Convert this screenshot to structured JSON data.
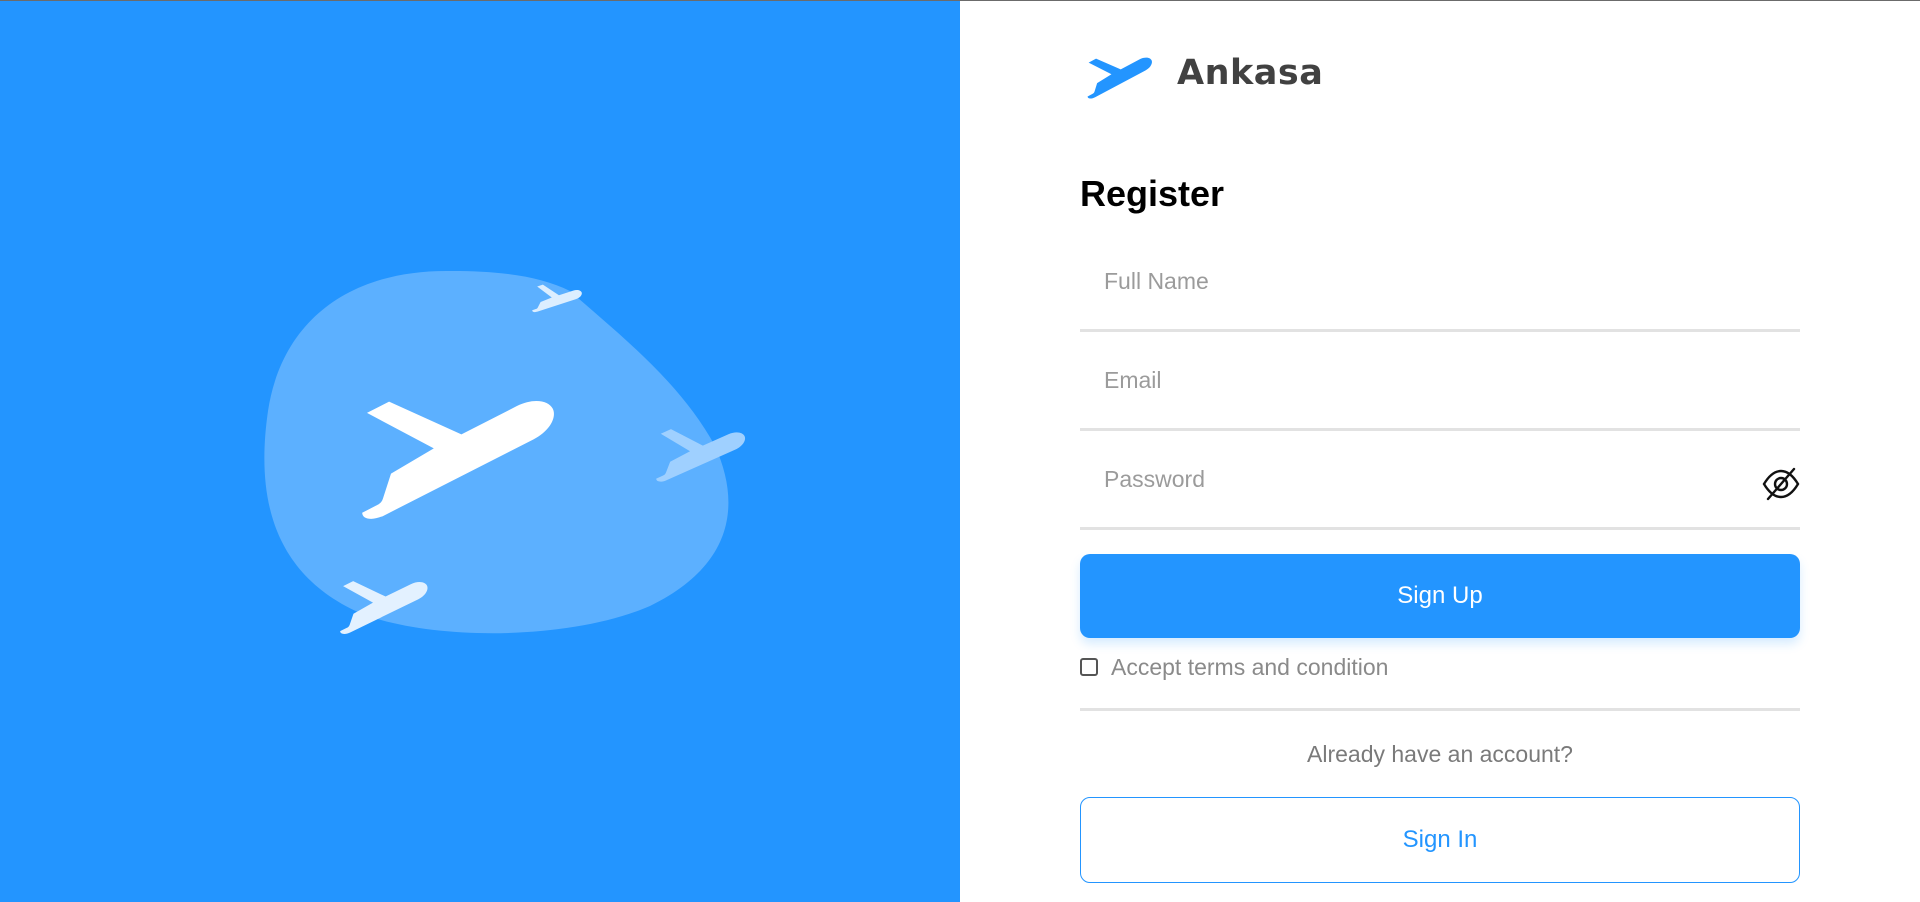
{
  "brand": {
    "name": "Ankasa",
    "logo_icon": "plane-logo-icon",
    "accent": "#2395FF"
  },
  "illustration": {
    "icon": "planes-illustration",
    "background": "#2395FF"
  },
  "form": {
    "title": "Register",
    "full_name": {
      "value": "",
      "placeholder": "Full Name"
    },
    "email": {
      "value": "",
      "placeholder": "Email"
    },
    "password": {
      "value": "",
      "placeholder": "Password",
      "toggle_icon": "eye-slash-icon"
    },
    "signup_label": "Sign Up",
    "terms": {
      "checked": false,
      "label": "Accept terms and condition"
    },
    "already_text": "Already have an account?",
    "signin_label": "Sign In"
  }
}
